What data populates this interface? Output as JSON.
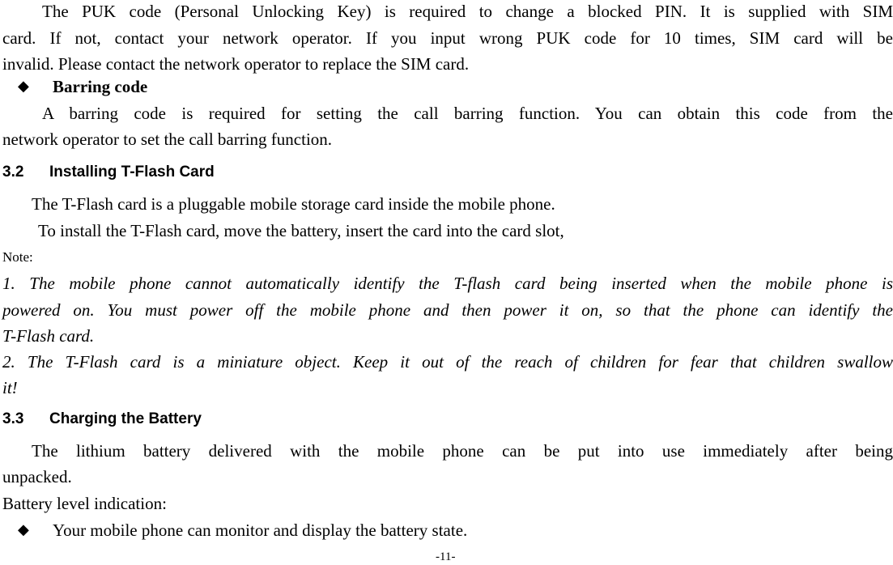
{
  "page": {
    "paragraph_puk": [
      "The PUK code (Personal Unlocking Key) is required to change a blocked PIN. It is supplied with SIM",
      "card. If not, contact your network operator. If you input wrong PUK code for 10 times, SIM card will be",
      "invalid. Please contact the network operator to replace the SIM card."
    ],
    "barring_heading": "Barring code",
    "paragraph_barring": [
      "A barring code is required for setting the call barring function. You can obtain this code from the",
      "network operator to set the call barring function."
    ],
    "section_32": {
      "number": "3.2",
      "title": "Installing T-Flash Card"
    },
    "tflash_lines": [
      "The T-Flash card is a pluggable mobile storage card inside the mobile phone.",
      "To install the T-Flash card, move the battery, insert the card into the card slot,"
    ],
    "note_label": "Note:",
    "notes": [
      "1. The mobile phone cannot automatically identify the T-flash card being inserted when the mobile phone is",
      "powered on. You must power off the mobile phone and then power it on, so that the phone can identify the",
      "T-Flash card.",
      "2. The T-Flash card is a miniature object. Keep it out of the reach of children for fear that children swallow",
      "it!"
    ],
    "section_33": {
      "number": "3.3",
      "title": "Charging the Battery"
    },
    "battery_lines": [
      "The lithium battery delivered with the mobile phone can be put into use immediately after being",
      "unpacked.",
      "Battery level indication:"
    ],
    "battery_bullet": "Your mobile phone can monitor and display the battery state.",
    "page_number": "-11-"
  }
}
